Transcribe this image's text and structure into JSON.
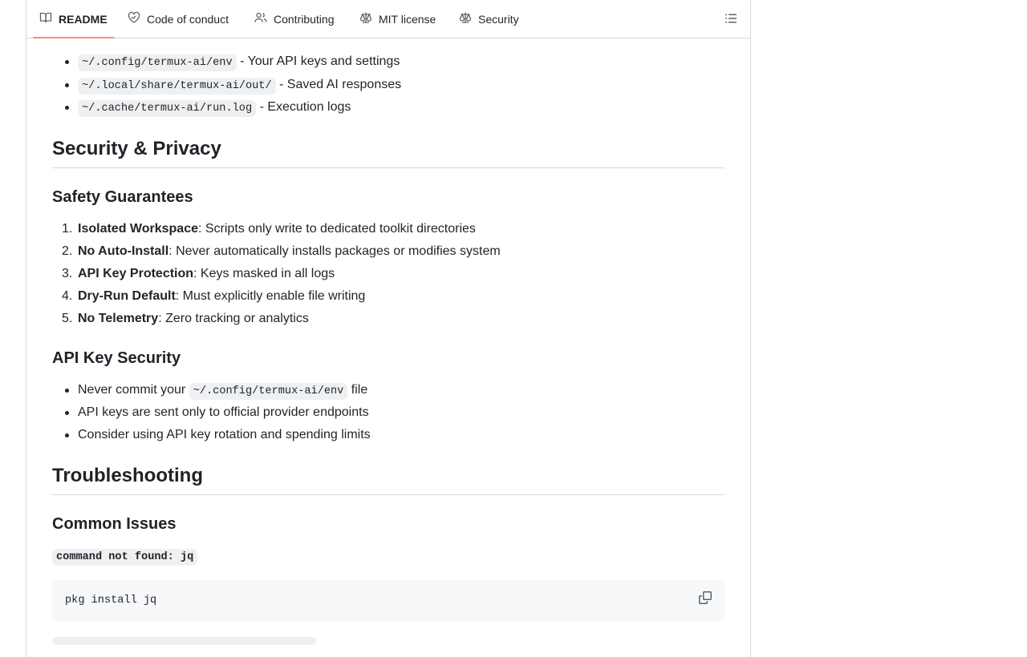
{
  "tabs": [
    {
      "label": "README",
      "icon": "book-icon",
      "active": true
    },
    {
      "label": "Code of conduct",
      "icon": "heart-handshake-icon"
    },
    {
      "label": "Contributing",
      "icon": "people-icon"
    },
    {
      "label": "MIT license",
      "icon": "scale-icon"
    },
    {
      "label": "Security",
      "icon": "scale-icon"
    }
  ],
  "files": [
    {
      "path": "~/.config/termux-ai/env",
      "desc": "- Your API keys and settings"
    },
    {
      "path": "~/.local/share/termux-ai/out/",
      "desc": "- Saved AI responses"
    },
    {
      "path": "~/.cache/termux-ai/run.log",
      "desc": "- Execution logs"
    }
  ],
  "security_heading": "Security & Privacy",
  "safety_heading": "Safety Guarantees",
  "guarantees": [
    {
      "num": "1.",
      "title": "Isolated Workspace",
      "text": ": Scripts only write to dedicated toolkit directories"
    },
    {
      "num": "2.",
      "title": "No Auto-Install",
      "text": ": Never automatically installs packages or modifies system"
    },
    {
      "num": "3.",
      "title": "API Key Protection",
      "text": ": Keys masked in all logs"
    },
    {
      "num": "4.",
      "title": "Dry-Run Default",
      "text": ": Must explicitly enable file writing"
    },
    {
      "num": "5.",
      "title": "No Telemetry",
      "text": ": Zero tracking or analytics"
    }
  ],
  "api_heading": "API Key Security",
  "api_items": {
    "first_pre": "Never commit your ",
    "first_code": "~/.config/termux-ai/env",
    "first_post": " file",
    "second": "API keys are sent only to official provider endpoints",
    "third": "Consider using API key rotation and spending limits"
  },
  "troubleshooting_heading": "Troubleshooting",
  "common_heading": "Common Issues",
  "issue_title": "command not found: jq",
  "code_block": "pkg install jq"
}
